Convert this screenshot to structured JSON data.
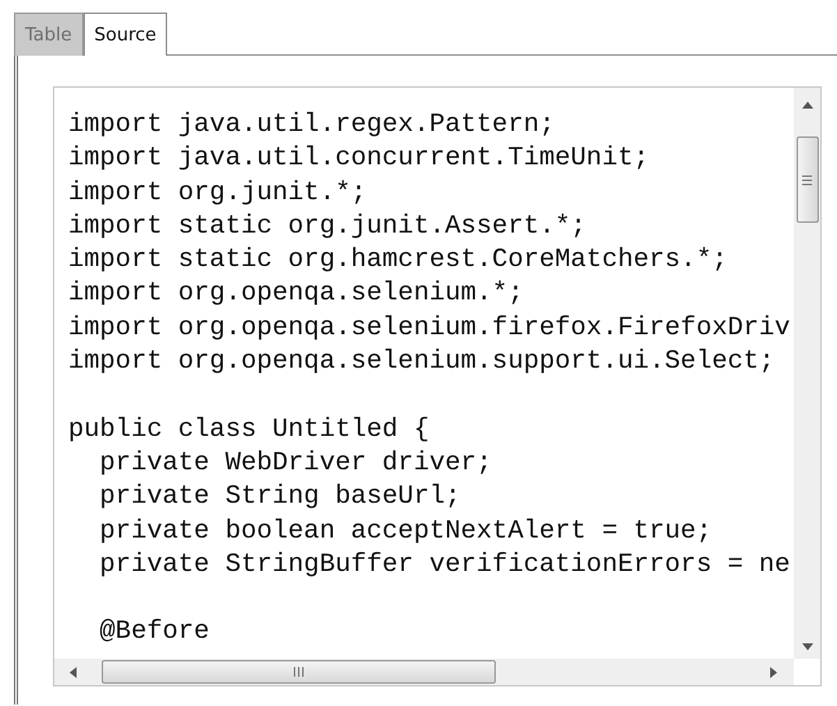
{
  "tabs": [
    {
      "label": "Table",
      "selected": false
    },
    {
      "label": "Source",
      "selected": true
    }
  ],
  "source": {
    "blocks": [
      [
        "import java.util.regex.Pattern;",
        "import java.util.concurrent.TimeUnit;",
        "import org.junit.*;",
        "import static org.junit.Assert.*;",
        "import static org.hamcrest.CoreMatchers.*;",
        "import org.openqa.selenium.*;",
        "import org.openqa.selenium.firefox.FirefoxDriv",
        "import org.openqa.selenium.support.ui.Select;"
      ],
      [
        "public class Untitled {",
        "  private WebDriver driver;",
        "  private String baseUrl;",
        "  private boolean acceptNextAlert = true;",
        "  private StringBuffer verificationErrors = ne"
      ],
      [
        "  @Before"
      ]
    ]
  }
}
